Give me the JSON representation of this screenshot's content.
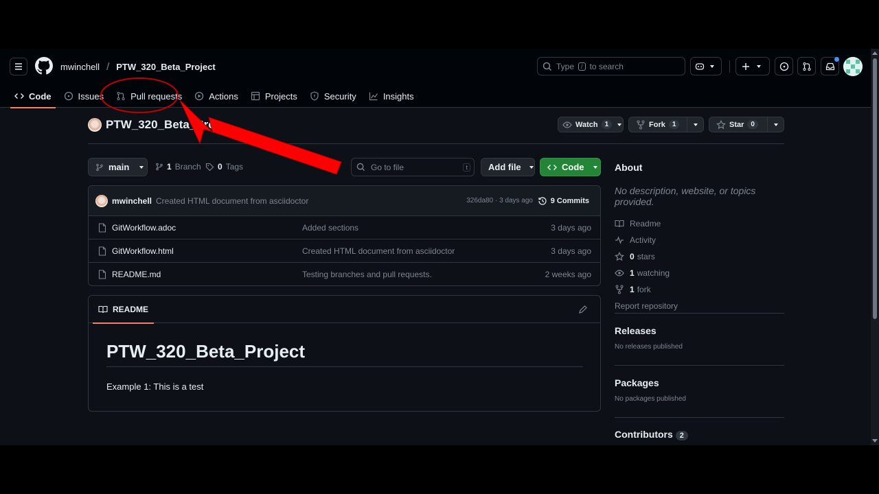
{
  "header": {
    "owner": "mwinchell",
    "separator": "/",
    "repo": "PTW_320_Beta_Project",
    "search_prefix": "Type",
    "search_key": "/",
    "search_suffix": "to search"
  },
  "tabs": [
    {
      "label": "Code"
    },
    {
      "label": "Issues"
    },
    {
      "label": "Pull requests"
    },
    {
      "label": "Actions"
    },
    {
      "label": "Projects"
    },
    {
      "label": "Security"
    },
    {
      "label": "Insights"
    }
  ],
  "repo_header": {
    "name": "PTW_320_Beta_Proj",
    "watch_label": "Watch",
    "watch_count": "1",
    "fork_label": "Fork",
    "fork_count": "1",
    "star_label": "Star",
    "star_count": "0"
  },
  "toolbar": {
    "branch": "main",
    "branch_count": "1",
    "branch_label": "Branch",
    "tag_count": "0",
    "tag_label": "Tags",
    "goto_placeholder": "Go to file",
    "goto_key": "t",
    "add_file": "Add file",
    "code_button": "Code"
  },
  "latest_commit": {
    "author": "mwinchell",
    "message": "Created HTML document from asciidoctor",
    "sha_time": "326da80 · 3 days ago",
    "commits": "9 Commits"
  },
  "files": [
    {
      "name": "GitWorkflow.adoc",
      "message": "Added sections",
      "date": "3 days ago"
    },
    {
      "name": "GitWorkflow.html",
      "message": "Created HTML document from asciidoctor",
      "date": "3 days ago"
    },
    {
      "name": "README.md",
      "message": "Testing branches and pull requests.",
      "date": "2 weeks ago"
    }
  ],
  "readme": {
    "tab": "README",
    "title": "PTW_320_Beta_Project",
    "body": "Example 1: This is a test"
  },
  "about": {
    "heading": "About",
    "description": "No description, website, or topics provided.",
    "readme": "Readme",
    "activity": "Activity",
    "stars_count": "0",
    "stars_label": "stars",
    "watching_count": "1",
    "watching_label": "watching",
    "fork_count": "1",
    "fork_label": "fork",
    "report": "Report repository"
  },
  "releases": {
    "heading": "Releases",
    "text": "No releases published"
  },
  "packages": {
    "heading": "Packages",
    "text": "No packages published"
  },
  "contributors": {
    "heading": "Contributors",
    "count": "2"
  },
  "colors": {
    "background": "#0d1117",
    "header": "#010409",
    "border": "#30363d",
    "accent_tab": "#f78166",
    "code_button": "#238636",
    "annotation": "#ff0000"
  }
}
